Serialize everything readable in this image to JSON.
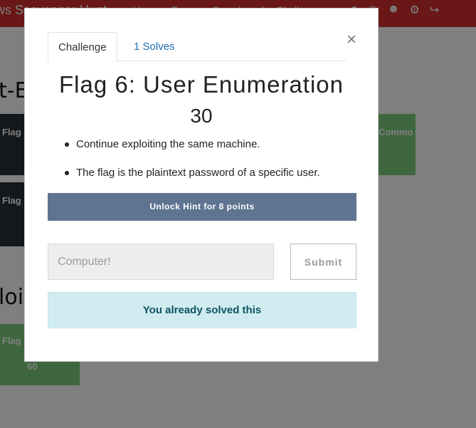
{
  "navbar": {
    "brand": "ws Scavenger Hunt",
    "links": [
      "Users",
      "Teams",
      "Scoreboard",
      "Challenges"
    ],
    "icons": [
      "bell-icon",
      "users-icon",
      "user-circle-icon",
      "cogs-icon",
      "sign-out-icon"
    ]
  },
  "background": {
    "heading_1": "t-E",
    "heading_2": "loit",
    "card_1": "Flag",
    "card_2": "Flag",
    "card_3": "Flag",
    "card_3_points": "60",
    "card_right": "Commo"
  },
  "modal": {
    "tabs": {
      "challenge": "Challenge",
      "solves": "1 Solves"
    },
    "close": "×",
    "title": "Flag 6: User Enumeration",
    "points": "30",
    "description": [
      "Continue exploiting the same machine.",
      "The flag is the plaintext password of a specific user."
    ],
    "hint_button": "Unlock Hint for 8 points",
    "answer": {
      "value": "Computer!"
    },
    "submit_button": "Submit",
    "alert": "You already solved this"
  },
  "colors": {
    "navbar": "#d32f2f",
    "hint_button": "#5e7491",
    "alert_bg": "#d1ecf1",
    "alert_text": "#0c5460",
    "tab_link": "#1f6fb2"
  }
}
